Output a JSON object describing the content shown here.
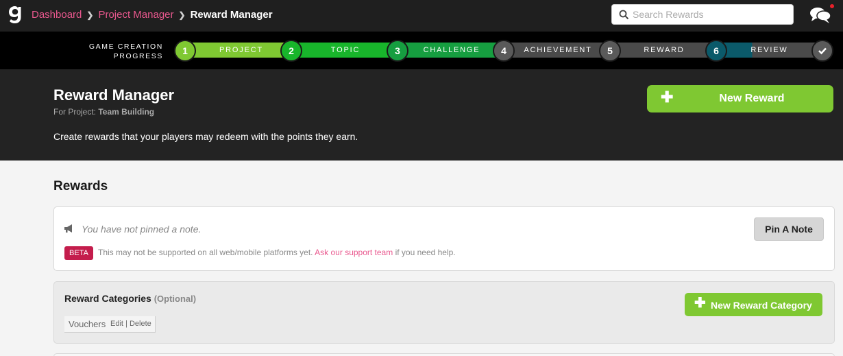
{
  "colors": {
    "accent_green": "#7fc832",
    "link_pink": "#e9588e",
    "beta_red": "#c41d4c",
    "dark_bg": "#232323"
  },
  "topbar": {
    "logo_icon": "logo-g-icon",
    "breadcrumb": [
      {
        "label": "Dashboard"
      },
      {
        "label": "Project Manager"
      },
      {
        "label": "Reward Manager"
      }
    ],
    "search": {
      "placeholder": "Search Rewards",
      "value": "",
      "icon": "search-icon"
    },
    "chat_icon": "chat-bubbles-icon"
  },
  "progress": {
    "label_line1": "GAME CREATION",
    "label_line2": "PROGRESS",
    "steps": [
      {
        "num": "1",
        "label": "PROJECT",
        "status": "complete",
        "color": "#7fc832"
      },
      {
        "num": "2",
        "label": "TOPIC",
        "status": "complete",
        "color": "#18b52b"
      },
      {
        "num": "3",
        "label": "CHALLENGE",
        "status": "complete",
        "color": "#169e40"
      },
      {
        "num": "4",
        "label": "ACHIEVEMENT",
        "status": "incomplete",
        "color": "#4a4a4a"
      },
      {
        "num": "5",
        "label": "REWARD",
        "status": "incomplete",
        "color": "#4a4a4a"
      },
      {
        "num": "6",
        "label": "REVIEW",
        "status": "current",
        "color": "#0b5a6a"
      }
    ],
    "final_icon": "checkmark-icon"
  },
  "header": {
    "title": "Reward Manager",
    "for_project_label": "For Project:",
    "project_name": "Team Building",
    "intro": "Create rewards that your players may redeem with the points they earn.",
    "new_reward_button": "New Reward"
  },
  "rewards": {
    "section_title": "Rewards",
    "note": {
      "text": "You have not pinned a note.",
      "pin_button": "Pin A Note",
      "beta_badge": "BETA",
      "beta_text_before": "This may not be supported on all web/mobile platforms yet.",
      "beta_link": "Ask our support team",
      "beta_text_after": "if you need help."
    },
    "categories": {
      "title": "Reward Categories",
      "optional": "(Optional)",
      "new_button": "New Reward Category",
      "items": [
        {
          "name": "Vouchers",
          "edit": "Edit",
          "separator": "|",
          "delete": "Delete"
        }
      ]
    }
  }
}
